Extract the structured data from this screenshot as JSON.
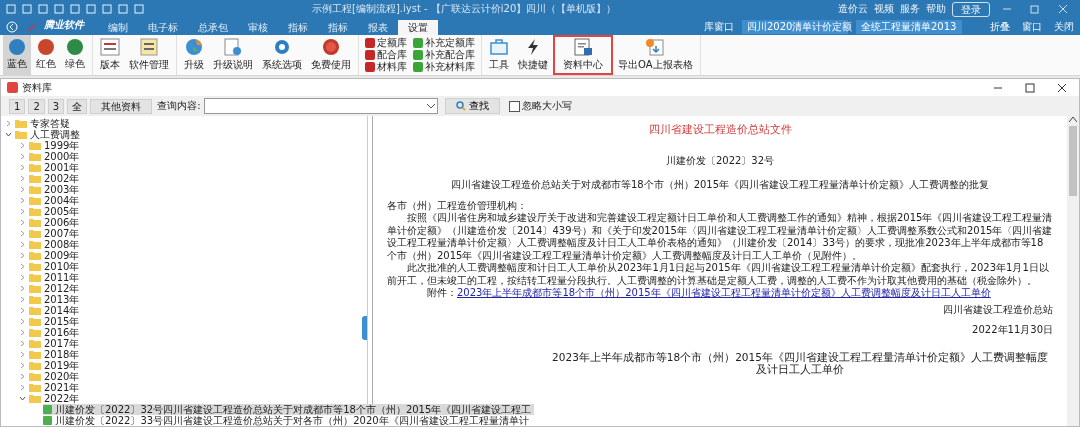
{
  "window": {
    "title": "示例工程[编制流程].iyst - 【广联达云计价i20】四川（【单机版】）"
  },
  "header_links": [
    {
      "label": "造价云"
    },
    {
      "label": "视频"
    },
    {
      "label": "服务"
    },
    {
      "label": "帮助"
    }
  ],
  "login_button": "登录",
  "brand": "腾业软件",
  "menu_tabs": [
    {
      "label": "编制",
      "selected": false
    },
    {
      "label": "电子标",
      "selected": false
    },
    {
      "label": "总承包",
      "selected": false
    },
    {
      "label": "审核",
      "selected": false
    },
    {
      "label": "指标",
      "selected": false
    },
    {
      "label": "指标",
      "selected": false
    },
    {
      "label": "报表",
      "selected": false
    },
    {
      "label": "设置",
      "selected": true
    }
  ],
  "library_window": "库窗口",
  "dropdowns": [
    {
      "value": "四川2020清单计价定额"
    },
    {
      "value": "全统工程量清单2013"
    }
  ],
  "panel_actions": [
    {
      "label": "折叠"
    },
    {
      "label": "窗口"
    },
    {
      "label": "关闭"
    }
  ],
  "ribbon": [
    {
      "items": [
        {
          "kind": "swatch",
          "label": "蓝色",
          "color": "#2f7fc1",
          "selected": true
        },
        {
          "kind": "swatch",
          "label": "红色",
          "color": "#c8472c",
          "selected": false
        },
        {
          "kind": "swatch",
          "label": "绿色",
          "color": "#2e8b47",
          "selected": false
        }
      ]
    },
    {
      "items": [
        {
          "kind": "large",
          "label": "版本",
          "highlighted": false
        },
        {
          "kind": "large",
          "label": "软件管理",
          "highlighted": false
        }
      ]
    },
    {
      "items": [
        {
          "kind": "large",
          "label": "升级",
          "highlighted": false
        },
        {
          "kind": "large",
          "label": "升级说明",
          "highlighted": false
        },
        {
          "kind": "large",
          "label": "系统选项",
          "highlighted": false
        },
        {
          "kind": "large",
          "label": "免费使用",
          "highlighted": false
        }
      ]
    },
    {
      "items": [
        {
          "kind": "small",
          "label": "定额库",
          "color": "#c62828"
        },
        {
          "kind": "small",
          "label": "配合库",
          "color": "#c62828"
        },
        {
          "kind": "small",
          "label": "材料库",
          "color": "#c62828"
        },
        {
          "kind": "small",
          "label": "补充定额库",
          "color": "#3aa637"
        },
        {
          "kind": "small",
          "label": "补充配合库",
          "color": "#3aa637"
        },
        {
          "kind": "small",
          "label": "补充材料库",
          "color": "#3aa637"
        }
      ]
    },
    {
      "items": [
        {
          "kind": "large",
          "label": "工具",
          "highlighted": false
        },
        {
          "kind": "large",
          "label": "快捷键",
          "highlighted": false
        },
        {
          "kind": "large",
          "label": "资料中心",
          "highlighted": true
        },
        {
          "kind": "large",
          "label": "导出OA上报表格",
          "highlighted": false
        }
      ]
    }
  ],
  "dialog": {
    "title": "资料库",
    "toolbar": {
      "buttons": [
        {
          "label": "1"
        },
        {
          "label": "2"
        },
        {
          "label": "3"
        },
        {
          "label": "全"
        },
        {
          "label": "其他资料"
        }
      ],
      "query_label": "查询内容:",
      "search_button": "查找",
      "ignore_case": {
        "label": "忽略大小写",
        "checked": false
      }
    },
    "tree": [
      {
        "kind": "folder",
        "label": "专家答疑",
        "expanded": false,
        "selected": false
      },
      {
        "kind": "folder",
        "label": "人工费调整",
        "expanded": true,
        "selected": false,
        "children": [
          {
            "kind": "folder",
            "label": "1999年",
            "expanded": false,
            "selected": false
          },
          {
            "kind": "folder",
            "label": "2000年",
            "expanded": false,
            "selected": false
          },
          {
            "kind": "folder",
            "label": "2001年",
            "expanded": false,
            "selected": false
          },
          {
            "kind": "folder",
            "label": "2002年",
            "expanded": false,
            "selected": false
          },
          {
            "kind": "folder",
            "label": "2003年",
            "expanded": false,
            "selected": false
          },
          {
            "kind": "folder",
            "label": "2004年",
            "expanded": false,
            "selected": false
          },
          {
            "kind": "folder",
            "label": "2005年",
            "expanded": false,
            "selected": false
          },
          {
            "kind": "folder",
            "label": "2006年",
            "expanded": false,
            "selected": false
          },
          {
            "kind": "folder",
            "label": "2007年",
            "expanded": false,
            "selected": false
          },
          {
            "kind": "folder",
            "label": "2008年",
            "expanded": false,
            "selected": false
          },
          {
            "kind": "folder",
            "label": "2009年",
            "expanded": false,
            "selected": false
          },
          {
            "kind": "folder",
            "label": "2010年",
            "expanded": false,
            "selected": false
          },
          {
            "kind": "folder",
            "label": "2011年",
            "expanded": false,
            "selected": false
          },
          {
            "kind": "folder",
            "label": "2012年",
            "expanded": false,
            "selected": false
          },
          {
            "kind": "folder",
            "label": "2013年",
            "expanded": false,
            "selected": false
          },
          {
            "kind": "folder",
            "label": "2014年",
            "expanded": false,
            "selected": false
          },
          {
            "kind": "folder",
            "label": "2015年",
            "expanded": false,
            "selected": false
          },
          {
            "kind": "folder",
            "label": "2016年",
            "expanded": false,
            "selected": false
          },
          {
            "kind": "folder",
            "label": "2017年",
            "expanded": false,
            "selected": false
          },
          {
            "kind": "folder",
            "label": "2018年",
            "expanded": false,
            "selected": false
          },
          {
            "kind": "folder",
            "label": "2019年",
            "expanded": false,
            "selected": false
          },
          {
            "kind": "folder",
            "label": "2020年",
            "expanded": false,
            "selected": false
          },
          {
            "kind": "folder",
            "label": "2021年",
            "expanded": false,
            "selected": false
          },
          {
            "kind": "folder",
            "label": "2022年",
            "expanded": true,
            "selected": false,
            "children": [
              {
                "kind": "document",
                "label": "川建价发〔2022〕32号四川省建设工程造价总站关于对成都市等18个市（州）2015年《四川省建设工程工",
                "selected": true
              },
              {
                "kind": "document",
                "label": "川建价发〔2022〕33号四川省建设工程造价总站关于对各市（州）2020年《四川省建设工程工程量清单计",
                "selected": false
              }
            ]
          }
        ]
      }
    ],
    "document": [
      {
        "kind": "title",
        "text": "四川省建设工程造价总站文件"
      },
      {
        "kind": "doc-number",
        "text": "川建价发〔2022〕32号"
      },
      {
        "kind": "heading",
        "text": "四川省建设工程造价总站关于对成都市等18个市（州）2015年《四川省建设工程工程量清单计价定额》人工费调整的批复"
      },
      {
        "kind": "salutation",
        "text": "各市（州）工程造价管理机构："
      },
      {
        "kind": "paragraph",
        "text": "按照《四川省住房和城乡建设厅关于改进和完善建设工程定额计日工单价和人工费调整工作的通知》精神，根据2015年《四川省建设工程工程量清单计价定额》（川建造价发〔2014〕439号）和《关于印发2015年〈四川省建设工程工程量清单计价定额〉人工费调整系数公式和2015年〈四川省建设工程工程量清单计价定额〉人工费调整幅度及计日工人工单价表格的通知》（川建价发〔2014〕33号）的要求，现批准2023年上半年成都市等18个市（州）2015年《四川省建设工程工程量清单计价定额》人工费调整幅度及计日工人工单价（见附件）。"
      },
      {
        "kind": "paragraph",
        "text": "此次批准的人工费调整幅度和计日工人工单价从2023年1月1日起与2015年《四川省建设工程工程量清单计价定额》配套执行，2023年1月1日以前开工，但未竣工的工程，按结转工程量分段执行。人工费调整的计算基础是定额人工费，调整的人工费不作为计取其他费用的基础（税金除外）。"
      },
      {
        "kind": "attachment",
        "label": "附件：",
        "link": "2023年上半年成都市等18个市（州）2015年《四川省建设工程工程量清单计价定额》人工费调整幅度及计日工人工单价"
      },
      {
        "kind": "signature",
        "text": "四川省建设工程造价总站"
      },
      {
        "kind": "date",
        "text": "2022年11月30日"
      },
      {
        "kind": "section-title",
        "text": "2023年上半年成都市等18个市（州）2015年《四川省建设工程工程量清单计价定额》人工费调整幅度及计日工人工单价"
      }
    ]
  }
}
